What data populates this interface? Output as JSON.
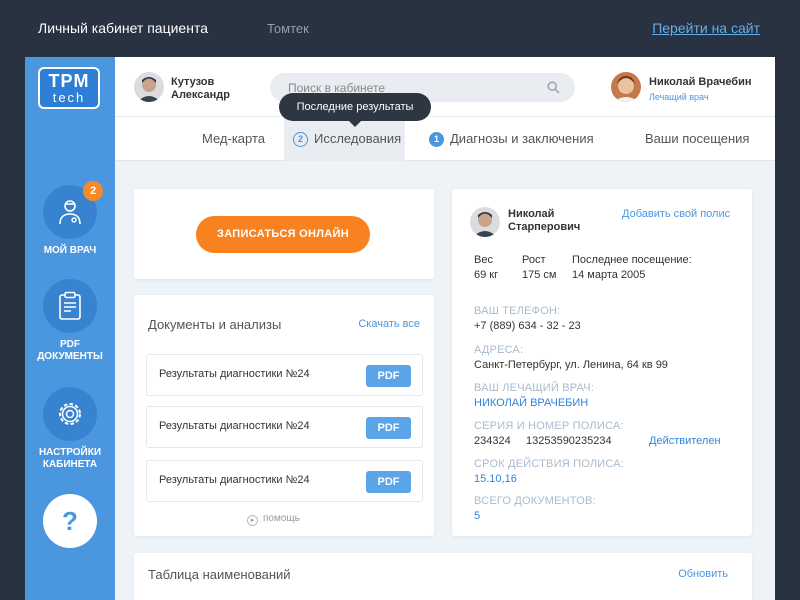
{
  "topbar": {
    "title": "Личный кабинет пациента",
    "company": "Томтек",
    "site_link": "Перейти на сайт"
  },
  "logo": {
    "line1": "TPM",
    "line2": "tech"
  },
  "sidebar": {
    "items": [
      {
        "label": "МОЙ ВРАЧ",
        "badge": "2",
        "icon": "doctor-icon"
      },
      {
        "label": "PDF ДОКУМЕНТЫ",
        "icon": "clipboard-icon"
      },
      {
        "label": "НАСТРОЙКИ КАБИНЕТА",
        "icon": "gear-icon"
      },
      {
        "label": "?",
        "icon": "help-icon"
      }
    ]
  },
  "header": {
    "user_first": "Кутузов",
    "user_last": "Александр",
    "search_placeholder": "Поиск в кабинете",
    "doctor_name": "Николай Врачебин",
    "doctor_role": "Лечащий врач"
  },
  "tabs": [
    {
      "label": "Мед-карта"
    },
    {
      "label": "Исследования",
      "num": "2"
    },
    {
      "label": "Диагнозы и заключения",
      "num": "1"
    },
    {
      "label": "Ваши посещения"
    }
  ],
  "tooltip": "Последние результаты",
  "cta_label": "ЗАПИСАТЬСЯ ОНЛАЙН",
  "documents": {
    "title": "Документы и анализы",
    "download_all": "Скачать все",
    "rows": [
      {
        "label": "Результаты диагностики №24",
        "button": "PDF"
      },
      {
        "label": "Результаты диагностики №24",
        "button": "PDF"
      },
      {
        "label": "Результаты диагностики №24",
        "button": "PDF"
      }
    ],
    "help": "помощь"
  },
  "profile": {
    "first": "Николай",
    "last": "Старперович",
    "add_policy": "Добавить свой полис",
    "weight_label": "Вес",
    "weight_value": "69 кг",
    "height_label": "Рост",
    "height_value": "175 см",
    "visit_label": "Последнее посещение:",
    "visit_value": "14 марта 2005",
    "phone_label": "ВАШ ТЕЛЕФОН:",
    "phone_value": "+7 (889) 634 - 32 - 23",
    "address_label": "АДРЕСА:",
    "address_value": "Санкт-Петербург, ул. Ленина, 64 кв 99",
    "doctor_label": "ВАШ ЛЕЧАЩИЙ ВРАЧ:",
    "doctor_value": "НИКОЛАЙ ВРАЧЕБИН",
    "policy_label": "СЕРИЯ И НОМЕР ПОЛИСА:",
    "policy_value": "234324     13253590235234",
    "policy_status": "Действителен",
    "term_label": "СРОК ДЕЙСТВИЯ ПОЛИСА:",
    "term_value": "15.10,16",
    "docs_label": "ВСЕГО ДОКУМЕНТОВ:",
    "docs_value": "5"
  },
  "table": {
    "title": "Таблица наименований",
    "refresh": "Обновить"
  },
  "colors": {
    "accent": "#4a97e0",
    "cta": "#f7821f",
    "dark": "#283240"
  }
}
